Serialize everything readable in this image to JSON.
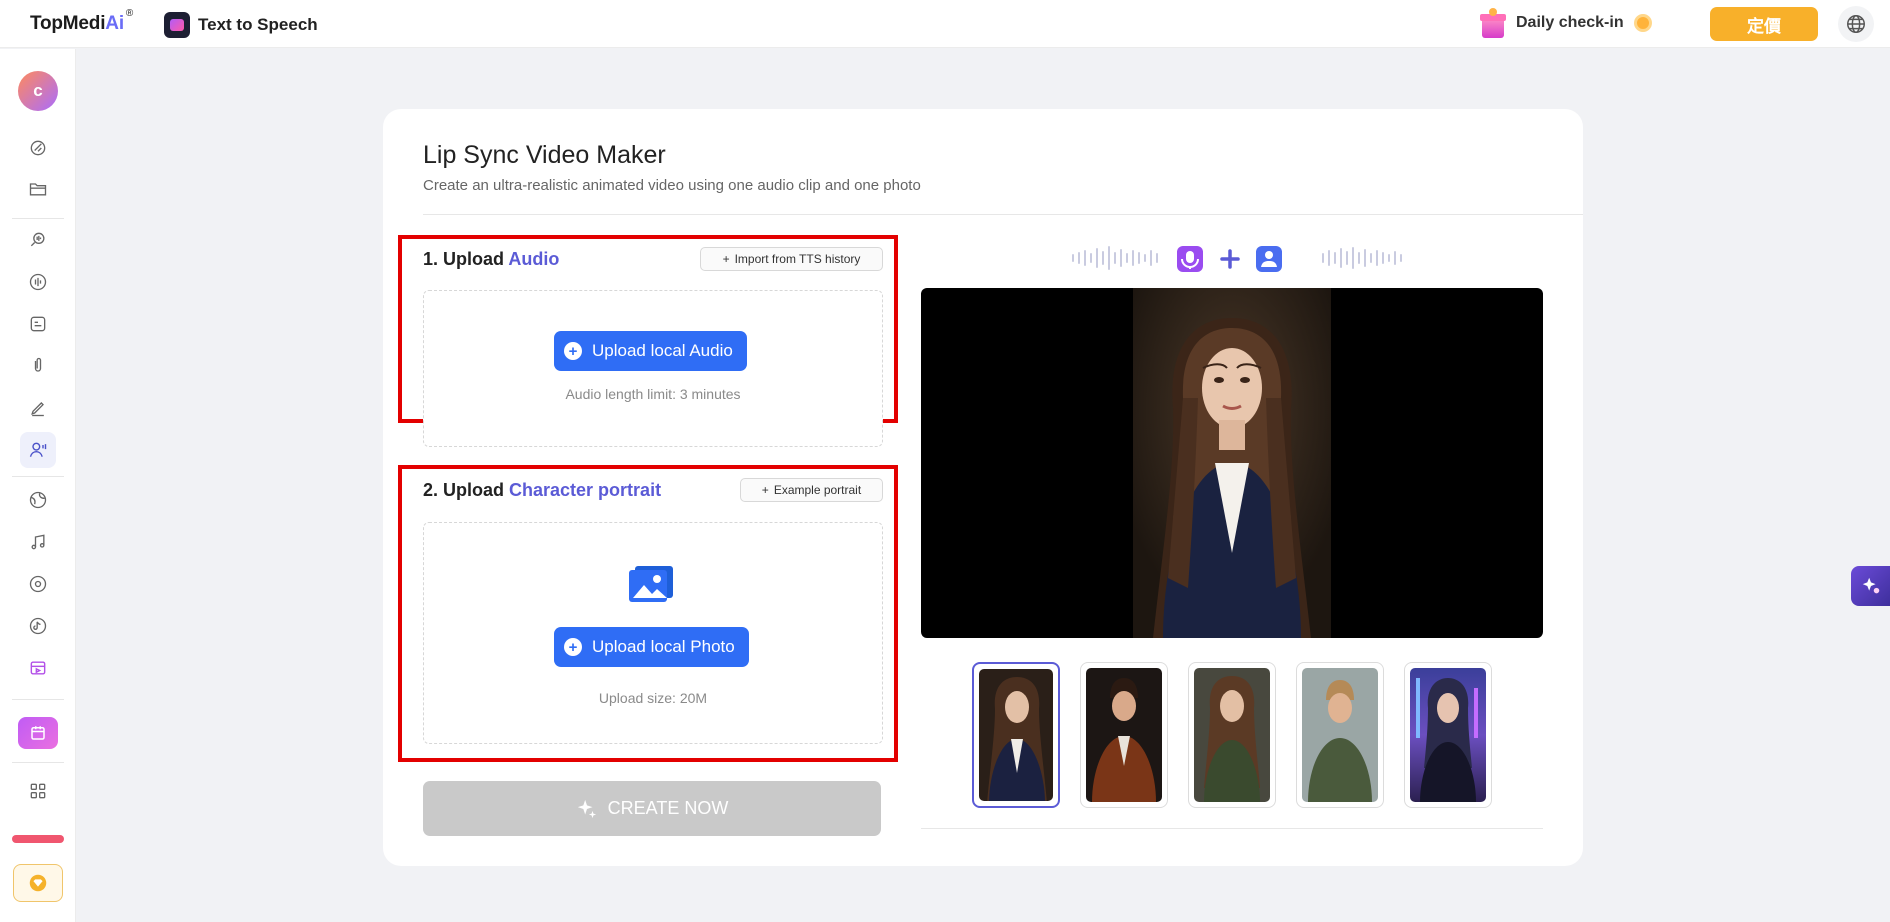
{
  "header": {
    "brand": "TopMedi",
    "brand_ai": "Ai",
    "brand_reg": "®",
    "app_name": "Text to Speech",
    "checkin": "Daily check-in",
    "pricing": "定價"
  },
  "sidebar": {
    "avatar_initial": "c",
    "items": [
      "palette-icon",
      "folder-icon",
      "voice-search-icon",
      "waveform-icon",
      "subtitle-icon",
      "clip-icon",
      "pen-icon",
      "lip-sync-icon",
      "globe-icon",
      "music-icon",
      "disc-icon",
      "tiktok-icon",
      "media-icon",
      "calendar-icon",
      "apps-icon",
      "vip-icon"
    ]
  },
  "main": {
    "title": "Lip Sync Video Maker",
    "subtitle": "Create an ultra-realistic animated video using one audio clip and one photo",
    "section1": {
      "title_prefix": "1. Upload ",
      "title_accent": "Audio",
      "side_button": "Import from TTS history",
      "upload_button": "Upload local Audio",
      "hint": "Audio length limit: 3 minutes"
    },
    "section2": {
      "title_prefix": "2. Upload ",
      "title_accent": "Character portrait",
      "side_button": "Example portrait",
      "upload_button": "Upload local Photo",
      "hint": "Upload size: 20M"
    },
    "create_button": "CREATE NOW",
    "thumbnails": [
      "woman-in-blazer",
      "man-in-brown-suit",
      "woman-in-green",
      "man-in-green-shirt",
      "cyberpunk-woman"
    ],
    "selected_thumbnail": 0
  },
  "colors": {
    "accent": "#5b5bd6",
    "primary_button": "#2f6df5",
    "pricing_button": "#f8b02a",
    "highlight_box": "#e30000"
  }
}
